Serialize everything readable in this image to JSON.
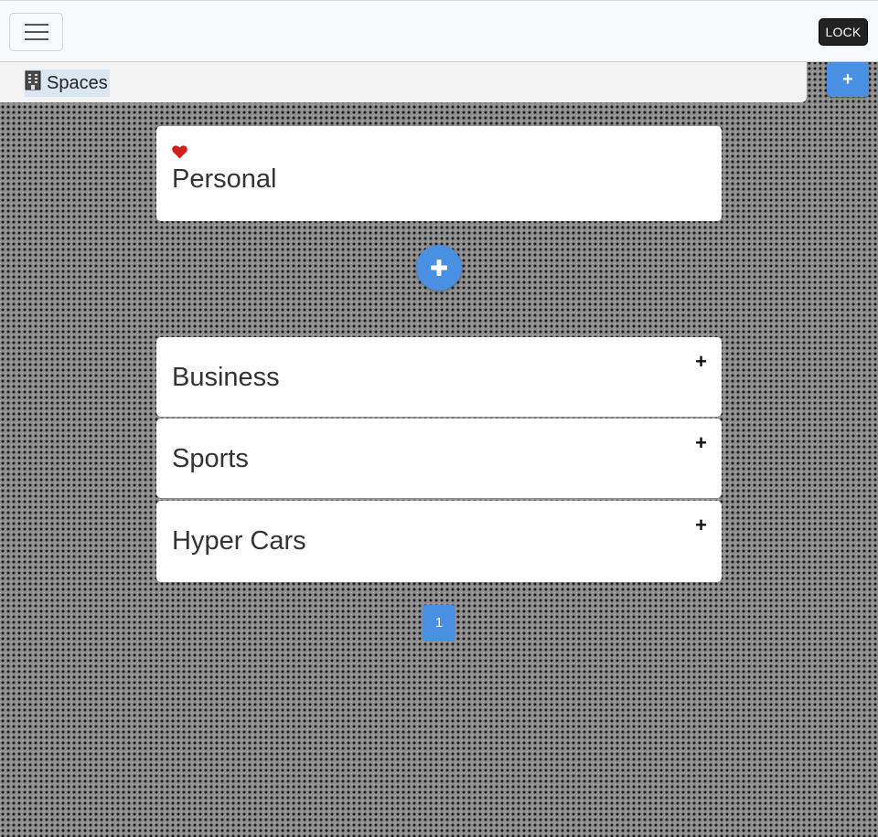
{
  "topbar": {
    "menu_icon": "hamburger-menu-icon",
    "lock_label": "LOCK"
  },
  "spaces_bar": {
    "icon": "building-icon",
    "label": "Spaces",
    "add_label": "+"
  },
  "favorite": {
    "icon": "heart-icon",
    "title": "Personal"
  },
  "add_group_icon": "plus-circle-icon",
  "groups": [
    {
      "title": "Business",
      "action": "+"
    },
    {
      "title": "Sports",
      "action": "+"
    },
    {
      "title": "Hyper Cars",
      "action": "+"
    }
  ],
  "pagination": {
    "current": "1"
  },
  "colors": {
    "accent": "#4a90e2",
    "heart": "#d0201e",
    "lock_bg": "#222222"
  }
}
